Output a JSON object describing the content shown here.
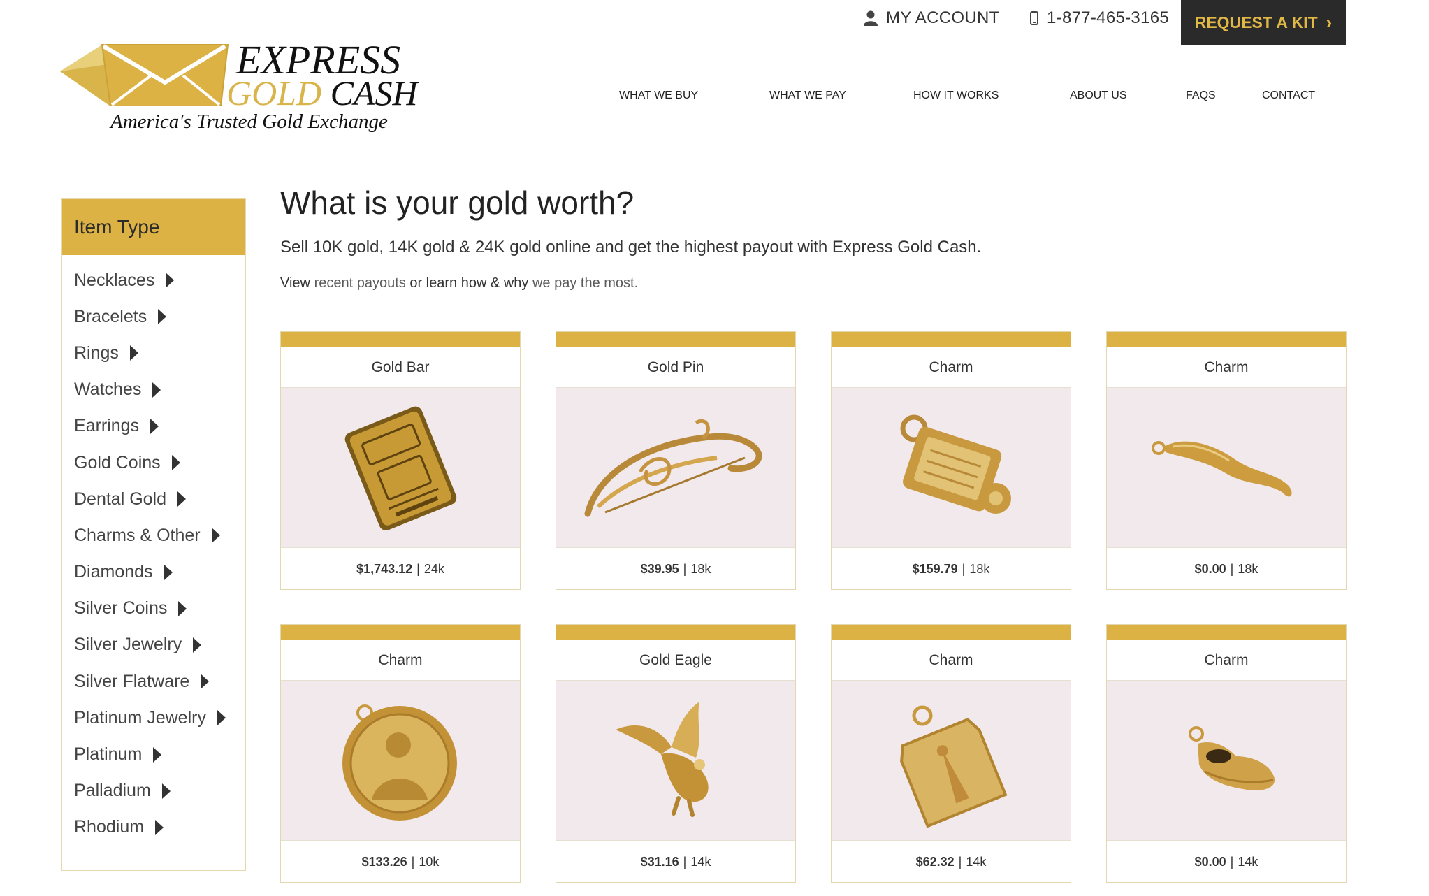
{
  "header": {
    "brand_line1": "EXPRESS",
    "brand_gold": "GOLD",
    "brand_cash": "CASH",
    "tagline": "America's Trusted Gold Exchange",
    "account_label": "MY ACCOUNT",
    "phone": "1-877-465-3165",
    "kit_label": "REQUEST A KIT",
    "nav": [
      "WHAT WE BUY",
      "WHAT WE PAY",
      "HOW IT WORKS",
      "ABOUT US",
      "FAQS",
      "CONTACT"
    ]
  },
  "sidebar": {
    "title": "Item Type",
    "items": [
      "Necklaces",
      "Bracelets",
      "Rings",
      "Watches",
      "Earrings",
      "Gold Coins",
      "Dental Gold",
      "Charms & Other",
      "Diamonds",
      "Silver Coins",
      "Silver Jewelry",
      "Silver Flatware",
      "Platinum Jewelry",
      "Platinum",
      "Palladium",
      "Rhodium"
    ]
  },
  "main": {
    "title": "What is your gold worth?",
    "intro": "Sell 10K gold, 14K gold & 24K gold online and get the highest payout with Express Gold Cash.",
    "sub_view": "View",
    "sub_link1": "recent payouts",
    "sub_or": "or learn how & why",
    "sub_link2": "we pay the most."
  },
  "cards": [
    {
      "name": "Gold Bar",
      "price": "$1,743.12",
      "karat": "24k",
      "image": "gold-bar"
    },
    {
      "name": "Gold Pin",
      "price": "$39.95",
      "karat": "18k",
      "image": "gold-pin"
    },
    {
      "name": "Charm",
      "price": "$159.79",
      "karat": "18k",
      "image": "locket-charm"
    },
    {
      "name": "Charm",
      "price": "$0.00",
      "karat": "18k",
      "image": "horn-charm"
    },
    {
      "name": "Charm",
      "price": "$133.26",
      "karat": "10k",
      "image": "medallion-charm"
    },
    {
      "name": "Gold Eagle",
      "price": "$31.16",
      "karat": "14k",
      "image": "eagle-charm"
    },
    {
      "name": "Charm",
      "price": "$62.32",
      "karat": "14k",
      "image": "tag-charm"
    },
    {
      "name": "Charm",
      "price": "$0.00",
      "karat": "14k",
      "image": "shoe-charm"
    }
  ],
  "colors": {
    "accent": "#dcb245",
    "dark": "#2b2a2a",
    "photo_bg": "#f2e9ec"
  }
}
